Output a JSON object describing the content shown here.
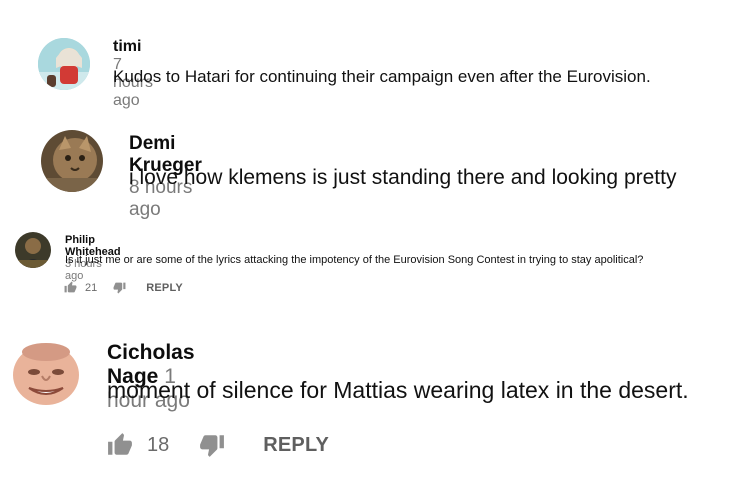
{
  "comments": [
    {
      "author": "timi",
      "time": "7 hours ago",
      "text": "Kudos to Hatari for continuing their campaign even after the Eurovision."
    },
    {
      "author": "Demi Krueger",
      "time": "8 hours ago",
      "text": "i love how klemens is just standing there and looking pretty"
    },
    {
      "author": "Philip Whitehead",
      "time": "3 hours ago",
      "text": "Is it just me or are some of the lyrics attacking the impotency of the Eurovision Song Contest in trying to stay apolitical?",
      "likes": "21",
      "reply_label": "REPLY"
    },
    {
      "author": "Cicholas Nage",
      "time": "1 hour ago",
      "text": "moment of silence for Mattias wearing latex in the desert.",
      "likes": "18",
      "reply_label": "REPLY"
    }
  ],
  "icons": {
    "like": "thumb-up-icon",
    "dislike": "thumb-down-icon"
  }
}
